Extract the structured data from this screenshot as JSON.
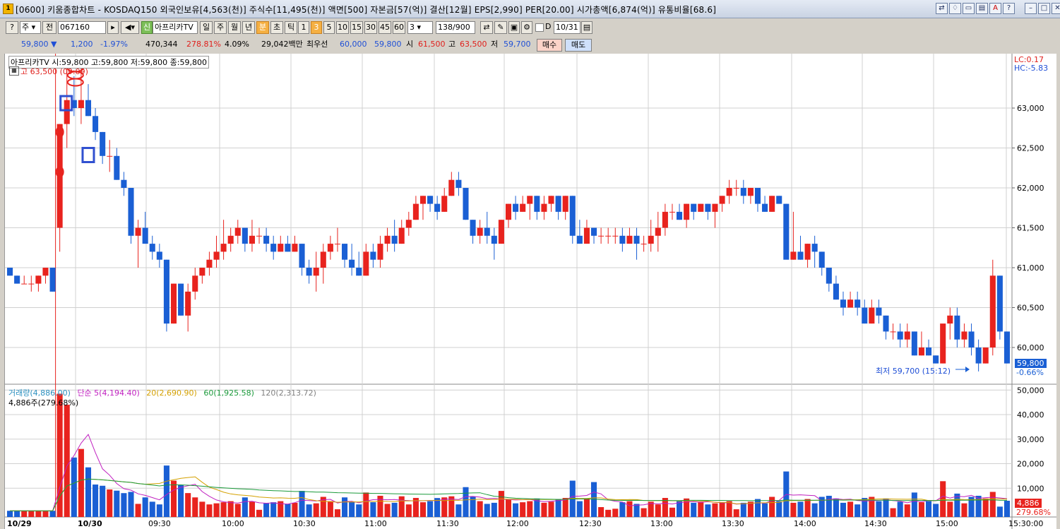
{
  "title": {
    "icon": "1",
    "text": "[0600] 키움종합차트 - KOSDAQ150 외국인보유[4,563(천)] 주식수[11,495(천)] 액면[500] 자본금[57(억)] 결산[12월] EPS[2,990] PER[20.00] 시가총액[6,874(억)] 유통비율[68.6]"
  },
  "window_buttons": [
    "⇄",
    "♢",
    "▭",
    "▤",
    "A",
    "?"
  ],
  "toolbar": {
    "period_select": "주",
    "prev_label": "전",
    "code": "067160",
    "stock_tag": "신",
    "stock_name": "아프리카TV",
    "tf_buttons": [
      "일",
      "주",
      "월",
      "년",
      "분",
      "초",
      "틱"
    ],
    "tf_selected": "분",
    "min_buttons": [
      "1",
      "3",
      "5",
      "10",
      "15",
      "30",
      "45",
      "60"
    ],
    "min_selected": "3",
    "interval_value": "3",
    "count_value": "138",
    "count_total": "/900",
    "date_value": "10/31"
  },
  "quote": {
    "price": "59,800",
    "arrow": "▼",
    "change": "1,200",
    "change_pct": "-1.97%",
    "volume": "470,344",
    "vol_ratio": "278.81%",
    "turnover": "4.09%",
    "amount": "29,042백만",
    "best_label": "최우선",
    "best_ask": "60,000",
    "best_bid": "59,800",
    "open_label": "시",
    "open": "61,500",
    "high_label": "고",
    "high": "63,500",
    "low_label": "저",
    "low": "59,700",
    "buy_label": "매수",
    "sell_label": "매도"
  },
  "price_pane": {
    "info": "아프리카TV 시:59,800 고:59,800 저:59,800 종:59,800",
    "high_marker": "고 63,500 (09:09)",
    "low_marker": "최저 59,700 (15:12)",
    "lc": "LC:0.17",
    "hc": "HC:-5.83",
    "y_ticks": [
      "63,000",
      "62,500",
      "62,000",
      "61,500",
      "61,000",
      "60,500",
      "60,000"
    ],
    "current_label": "59,800",
    "current_pct": "-0.66%"
  },
  "volume_pane": {
    "legend": [
      {
        "text": "거래량(4,886.00)",
        "color": "#2a8fbf"
      },
      {
        "text": "단순 5(4,194.40)",
        "color": "#c020c0"
      },
      {
        "text": "20(2,690.90)",
        "color": "#d4a000"
      },
      {
        "text": "60(1,925.58)",
        "color": "#1a9a3a"
      },
      {
        "text": "120(2,313.72)",
        "color": "#808080"
      }
    ],
    "sub": "4,886주(279.68%)",
    "y_ticks": [
      "50,000",
      "40,000",
      "30,000",
      "20,000",
      "10,000"
    ],
    "current_label": "4,886",
    "current_pct": "279.68%"
  },
  "x_axis": [
    "10/29",
    "10/30",
    "09:30",
    "10:00",
    "10:30",
    "11:00",
    "11:30",
    "12:00",
    "12:30",
    "13:00",
    "13:30",
    "14:00",
    "14:30",
    "15:00",
    "15:30:00"
  ],
  "colors": {
    "up": "#e8231e",
    "down": "#1a5fd4",
    "grid": "#d0d0d0"
  },
  "chart_data": {
    "type": "candlestick",
    "interval": "3분",
    "candles": [
      [
        61000,
        61000,
        60900,
        60900
      ],
      [
        60900,
        60900,
        60800,
        60800
      ],
      [
        60800,
        60900,
        60800,
        60800
      ],
      [
        60800,
        60900,
        60700,
        60800
      ],
      [
        60800,
        60900,
        60700,
        60900
      ],
      [
        60900,
        61000,
        60800,
        61000
      ],
      [
        61000,
        61000,
        60700,
        60700
      ],
      [
        61500,
        62800,
        61200,
        62800
      ],
      [
        62800,
        63500,
        62500,
        63100
      ],
      [
        63100,
        63400,
        62900,
        63000
      ],
      [
        63000,
        63500,
        62800,
        63100
      ],
      [
        63100,
        63300,
        62900,
        62900
      ],
      [
        62900,
        63000,
        62600,
        62700
      ],
      [
        62700,
        62700,
        62300,
        62400
      ],
      [
        62400,
        62600,
        62200,
        62400
      ],
      [
        62400,
        62500,
        62100,
        62100
      ],
      [
        62100,
        62200,
        61900,
        62000
      ],
      [
        62000,
        62000,
        61300,
        61400
      ],
      [
        61400,
        61600,
        61000,
        61500
      ],
      [
        61500,
        61700,
        61300,
        61300
      ],
      [
        61300,
        61400,
        61100,
        61200
      ],
      [
        61200,
        61300,
        61000,
        61100
      ],
      [
        61100,
        61100,
        60200,
        60300
      ],
      [
        60300,
        60800,
        60300,
        60800
      ],
      [
        60800,
        60800,
        60400,
        60400
      ],
      [
        60400,
        60800,
        60200,
        60700
      ],
      [
        60700,
        61000,
        60600,
        60900
      ],
      [
        60900,
        61000,
        60800,
        61000
      ],
      [
        61000,
        61200,
        60900,
        61100
      ],
      [
        61100,
        61400,
        61000,
        61200
      ],
      [
        61200,
        61600,
        61100,
        61300
      ],
      [
        61300,
        61500,
        61200,
        61400
      ],
      [
        61400,
        61600,
        61300,
        61500
      ],
      [
        61500,
        61500,
        61200,
        61300
      ],
      [
        61300,
        61600,
        61200,
        61400
      ],
      [
        61400,
        61500,
        61300,
        61400
      ],
      [
        61400,
        61500,
        61200,
        61300
      ],
      [
        61300,
        61400,
        61100,
        61200
      ],
      [
        61200,
        61400,
        61200,
        61300
      ],
      [
        61300,
        61400,
        61200,
        61200
      ],
      [
        61200,
        61400,
        61200,
        61300
      ],
      [
        61300,
        61300,
        60900,
        61000
      ],
      [
        61000,
        61100,
        60800,
        60900
      ],
      [
        60900,
        61200,
        60700,
        61000
      ],
      [
        61000,
        61300,
        60800,
        61200
      ],
      [
        61200,
        61400,
        61100,
        61300
      ],
      [
        61300,
        61500,
        61200,
        61300
      ],
      [
        61300,
        61300,
        61000,
        61100
      ],
      [
        61100,
        61300,
        60900,
        61000
      ],
      [
        61000,
        61200,
        60900,
        60900
      ],
      [
        60900,
        61300,
        60900,
        61200
      ],
      [
        61200,
        61300,
        61000,
        61100
      ],
      [
        61100,
        61400,
        61000,
        61300
      ],
      [
        61300,
        61500,
        61200,
        61400
      ],
      [
        61400,
        61600,
        61200,
        61300
      ],
      [
        61300,
        61600,
        61300,
        61500
      ],
      [
        61500,
        61700,
        61400,
        61600
      ],
      [
        61600,
        61900,
        61600,
        61800
      ],
      [
        61800,
        61900,
        61600,
        61900
      ],
      [
        61900,
        61900,
        61700,
        61800
      ],
      [
        61800,
        61900,
        61600,
        61700
      ],
      [
        61700,
        62000,
        61700,
        61900
      ],
      [
        61900,
        62200,
        61900,
        62100
      ],
      [
        62100,
        62200,
        61900,
        62000
      ],
      [
        62000,
        62000,
        61600,
        61600
      ],
      [
        61600,
        61600,
        61300,
        61400
      ],
      [
        61400,
        61600,
        61300,
        61500
      ],
      [
        61500,
        61700,
        61300,
        61400
      ],
      [
        61400,
        61500,
        61100,
        61300
      ],
      [
        61300,
        61600,
        61300,
        61600
      ],
      [
        61600,
        61800,
        61500,
        61800
      ],
      [
        61800,
        61900,
        61600,
        61700
      ],
      [
        61700,
        61900,
        61700,
        61800
      ],
      [
        61800,
        61900,
        61600,
        61900
      ],
      [
        61900,
        61900,
        61600,
        61700
      ],
      [
        61700,
        61900,
        61600,
        61800
      ],
      [
        61800,
        61900,
        61700,
        61900
      ],
      [
        61900,
        61900,
        61600,
        61700
      ],
      [
        61700,
        61900,
        61600,
        61900
      ],
      [
        61900,
        61900,
        61300,
        61400
      ],
      [
        61400,
        61600,
        61300,
        61300
      ],
      [
        61300,
        61600,
        61300,
        61500
      ],
      [
        61500,
        61500,
        61300,
        61400
      ],
      [
        61400,
        61500,
        61300,
        61400
      ],
      [
        61400,
        61500,
        61300,
        61400
      ],
      [
        61400,
        61500,
        61300,
        61400
      ],
      [
        61400,
        61500,
        61200,
        61300
      ],
      [
        61300,
        61500,
        61300,
        61400
      ],
      [
        61400,
        61500,
        61100,
        61300
      ],
      [
        61300,
        61400,
        61200,
        61300
      ],
      [
        61300,
        61600,
        61200,
        61400
      ],
      [
        61400,
        61700,
        61200,
        61500
      ],
      [
        61500,
        61800,
        61400,
        61700
      ],
      [
        61700,
        61800,
        61600,
        61700
      ],
      [
        61700,
        61800,
        61600,
        61600
      ],
      [
        61600,
        61800,
        61500,
        61800
      ],
      [
        61800,
        61800,
        61600,
        61700
      ],
      [
        61700,
        61800,
        61700,
        61800
      ],
      [
        61800,
        61800,
        61600,
        61700
      ],
      [
        61700,
        61800,
        61500,
        61800
      ],
      [
        61800,
        61900,
        61700,
        61900
      ],
      [
        61900,
        62100,
        61800,
        62000
      ],
      [
        62000,
        62100,
        61900,
        62000
      ],
      [
        62000,
        62100,
        61800,
        61900
      ],
      [
        61900,
        62000,
        61800,
        62000
      ],
      [
        62000,
        62000,
        61700,
        61800
      ],
      [
        61800,
        61900,
        61700,
        61700
      ],
      [
        61700,
        61900,
        61700,
        61900
      ],
      [
        61900,
        61900,
        61800,
        61800
      ],
      [
        61800,
        61800,
        61200,
        61100
      ],
      [
        61100,
        61700,
        61100,
        61200
      ],
      [
        61200,
        61400,
        61100,
        61100
      ],
      [
        61100,
        61300,
        61000,
        61300
      ],
      [
        61300,
        61400,
        61000,
        61200
      ],
      [
        61200,
        61200,
        60900,
        61000
      ],
      [
        61000,
        61000,
        60700,
        60800
      ],
      [
        60800,
        60900,
        60600,
        60600
      ],
      [
        60600,
        60700,
        60400,
        60500
      ],
      [
        60500,
        60700,
        60500,
        60600
      ],
      [
        60600,
        60700,
        60400,
        60500
      ],
      [
        60500,
        60600,
        60300,
        60300
      ],
      [
        60300,
        60600,
        60300,
        60500
      ],
      [
        60500,
        60600,
        60300,
        60400
      ],
      [
        60400,
        60400,
        60100,
        60200
      ],
      [
        60200,
        60300,
        60100,
        60200
      ],
      [
        60200,
        60300,
        60000,
        60100
      ],
      [
        60100,
        60300,
        60000,
        60200
      ],
      [
        60200,
        60200,
        59900,
        59900
      ],
      [
        59900,
        60200,
        59900,
        60000
      ],
      [
        60000,
        60100,
        59900,
        59900
      ],
      [
        59900,
        59900,
        59800,
        59800
      ],
      [
        59800,
        60200,
        59800,
        60300
      ],
      [
        60300,
        60500,
        60100,
        60400
      ],
      [
        60400,
        60500,
        60000,
        60100
      ],
      [
        60100,
        60300,
        60000,
        60200
      ],
      [
        60200,
        60300,
        59900,
        60000
      ],
      [
        60000,
        60100,
        59700,
        59800
      ],
      [
        59800,
        60000,
        59800,
        60000
      ],
      [
        60000,
        61100,
        59900,
        60900
      ],
      [
        60900,
        60900,
        60100,
        60200
      ],
      [
        60200,
        60200,
        59800,
        59800
      ]
    ]
  }
}
